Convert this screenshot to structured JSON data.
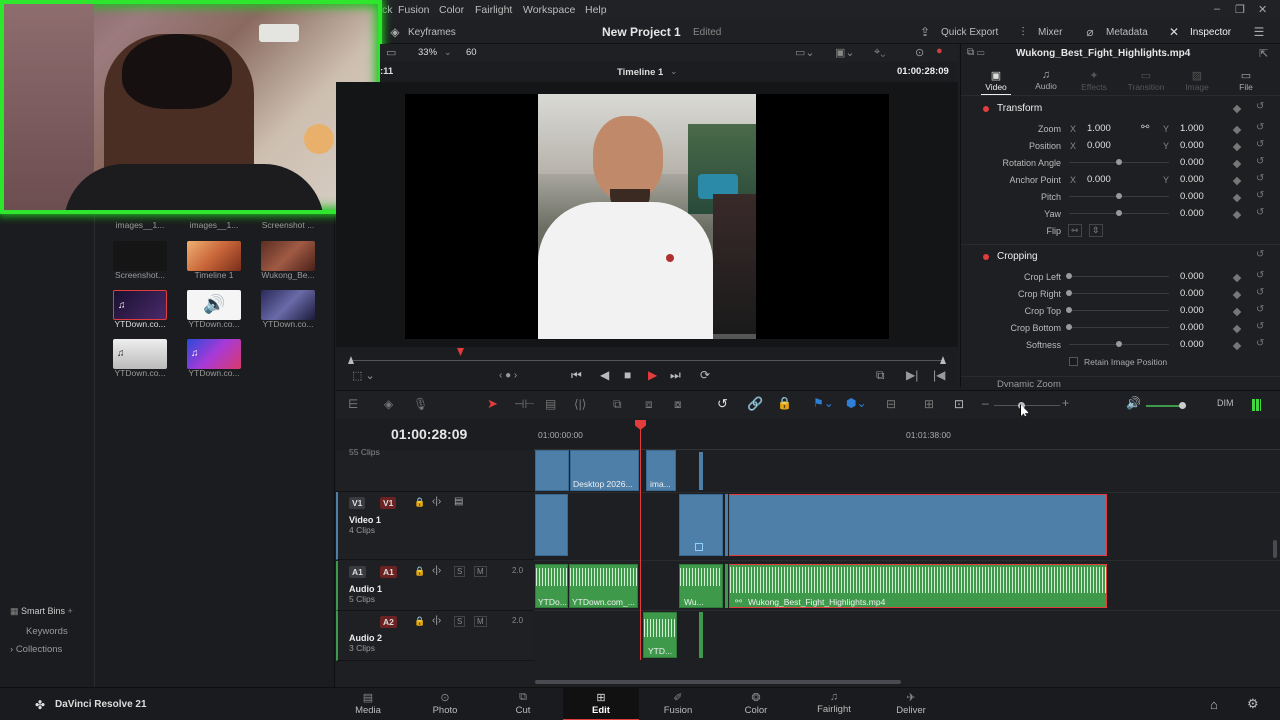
{
  "menubar": {
    "items": [
      "ck",
      "Fusion",
      "Color",
      "Fairlight",
      "Workspace",
      "Help"
    ],
    "window_controls": [
      "–",
      "❐",
      "✕"
    ]
  },
  "titlebar": {
    "keyframes": "Keyframes",
    "project_name": "New Project 1",
    "project_status": "Edited",
    "quick_export": "Quick Export",
    "mixer": "Mixer",
    "metadata": "Metadata",
    "inspector": "Inspector"
  },
  "viewer": {
    "zoom": "33%",
    "fps": "60",
    "timecode_left": ":11",
    "timeline_name": "Timeline 1",
    "timecode": "01:00:28:09"
  },
  "media_pool": {
    "row_partial": [
      "images__1...",
      "images__1...",
      "Screenshot ..."
    ],
    "thumbs": [
      {
        "label": "Screenshot...",
        "color": "#151515"
      },
      {
        "label": "Timeline 1",
        "color": "#c9663a"
      },
      {
        "label": "Wukong_Be...",
        "color": "#8a4a3a"
      },
      {
        "label": "YTDown.co...",
        "color": "#2a2040"
      },
      {
        "label": "YTDown.co...",
        "color": "#f5f5f5"
      },
      {
        "label": "YTDown.co...",
        "color": "#3a3a6a"
      },
      {
        "label": "YTDown.co...",
        "color": "#d8d8d8"
      },
      {
        "label": "YTDown.co...",
        "color": "#5a3aa8"
      }
    ],
    "smart_bins": "Smart Bins",
    "keywords": "Keywords",
    "collections": "Collections"
  },
  "inspector": {
    "clip_name": "Wukong_Best_Fight_Highlights.mp4",
    "tabs": [
      "Video",
      "Audio",
      "Effects",
      "Transition",
      "Image",
      "File"
    ],
    "transform_title": "Transform",
    "zoom_label": "Zoom",
    "zoom_x": "1.000",
    "zoom_y": "1.000",
    "position_label": "Position",
    "position_x": "0.000",
    "position_y": "0.000",
    "rotation_label": "Rotation Angle",
    "rotation": "0.000",
    "anchor_label": "Anchor Point",
    "anchor_x": "0.000",
    "anchor_y": "0.000",
    "pitch_label": "Pitch",
    "pitch": "0.000",
    "yaw_label": "Yaw",
    "yaw": "0.000",
    "flip_label": "Flip",
    "cropping_title": "Cropping",
    "crop_left_label": "Crop Left",
    "crop_left": "0.000",
    "crop_right_label": "Crop Right",
    "crop_right": "0.000",
    "crop_top_label": "Crop Top",
    "crop_top": "0.000",
    "crop_bottom_label": "Crop Bottom",
    "crop_bottom": "0.000",
    "softness_label": "Softness",
    "softness": "0.000",
    "retain_label": "Retain Image Position",
    "dynamic_zoom": "Dynamic Zoom",
    "x": "X",
    "y": "Y"
  },
  "timeline": {
    "timecode": "01:00:28:09",
    "ruler_start": "01:00:00:00",
    "ruler_mid": "01:01:38:00",
    "dim": "DIM",
    "v2_clips": "55 Clips",
    "v1_tag": "V1",
    "v1_name": "Video 1",
    "v1_clips": "4 Clips",
    "a1_tag": "A1",
    "a1_name": "Audio 1",
    "a1_clips": "5 Clips",
    "a1_level": "2.0",
    "a2_tag": "A2",
    "a2_name": "Audio 2",
    "a2_clips": "3 Clips",
    "a2_level": "2.0",
    "s": "S",
    "m": "M",
    "clip_desktop": "Desktop 2026...",
    "clip_ima": "ima...",
    "clip_yt1": "YTDo...",
    "clip_yt2": "YTDown.com_...",
    "clip_wu": "Wu...",
    "clip_wukong": "Wukong_Best_Fight_Highlights.mp4",
    "clip_ytd": "YTD..."
  },
  "app": {
    "name": "DaVinci Resolve 21"
  },
  "pages": [
    "Media",
    "Photo",
    "Cut",
    "Edit",
    "Fusion",
    "Color",
    "Fairlight",
    "Deliver"
  ],
  "colors": {
    "accent_red": "#e23c3c",
    "audio_green": "#3e9a4a",
    "video_blue": "#4d7fa8"
  }
}
